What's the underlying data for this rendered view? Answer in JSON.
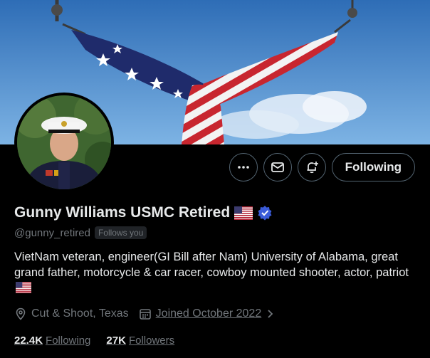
{
  "profile": {
    "display_name": "Gunny Williams USMC Retired",
    "handle": "@gunny_retired",
    "follows_you": "Follows you",
    "bio": "VietNam veteran, engineer(GI Bill after Nam) University of Alabama, great grand father, motorcycle & car racer, cowboy mounted shooter, actor, patriot",
    "location": "Cut & Shoot, Texas",
    "joined": "Joined October 2022",
    "following_count": "22.4K",
    "following_label": "Following",
    "followers_count": "27K",
    "followers_label": "Followers"
  },
  "actions": {
    "follow_state_label": "Following"
  },
  "icons": {
    "more": "more-icon",
    "message": "message-icon",
    "notifications": "bell-plus-icon",
    "verified": "verified-badge-icon",
    "location": "location-pin-icon",
    "calendar": "calendar-icon",
    "chevron": "chevron-right-icon",
    "flag": "us-flag-icon"
  },
  "colors": {
    "background": "#000000",
    "text_primary": "#e7e9ea",
    "text_secondary": "#71767b",
    "border": "#536471",
    "verified": "#1d9bf0"
  }
}
